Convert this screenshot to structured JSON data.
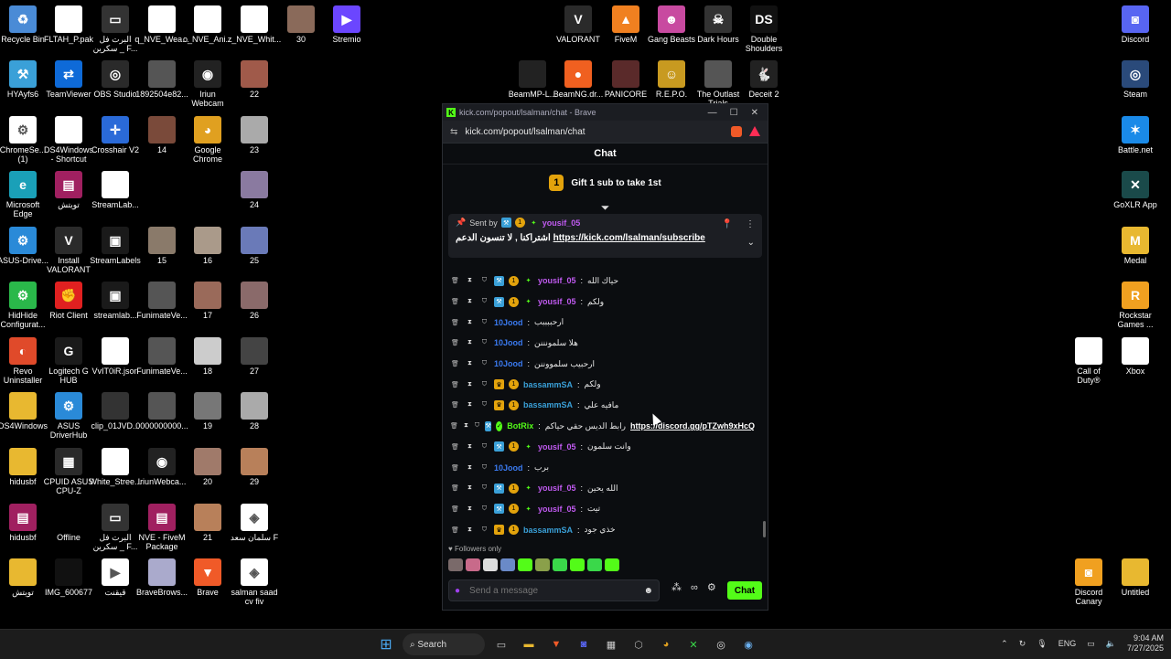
{
  "desktop_icons": [
    {
      "label": "Recycle Bin",
      "color": "#4a8bd6",
      "glyph": "♻"
    },
    {
      "label": "FLTAH_P.pak",
      "color": "#ffffff",
      "glyph": ""
    },
    {
      "label": "البرت فل\nسكرين _ F...",
      "color": "#333",
      "glyph": "▭"
    },
    {
      "label": "q_NVE_Wea...",
      "color": "#ffffff",
      "glyph": ""
    },
    {
      "label": "o_NVE_Ani...",
      "color": "#ffffff",
      "glyph": ""
    },
    {
      "label": "z_NVE_Whit...",
      "color": "#ffffff",
      "glyph": ""
    },
    {
      "label": "30",
      "color": "#8a6a5a",
      "glyph": ""
    },
    {
      "label": "Stremio",
      "color": "#6b46ff",
      "glyph": "▶"
    },
    {
      "label": "HYAyfs6",
      "color": "#3aa0d8",
      "glyph": "⚒"
    },
    {
      "label": "TeamViewer",
      "color": "#0e6ad8",
      "glyph": "⇄"
    },
    {
      "label": "OBS Studio",
      "color": "#2a2a2a",
      "glyph": "◎"
    },
    {
      "label": "1892504e82...",
      "color": "#555",
      "glyph": ""
    },
    {
      "label": "Iriun\nWebcam",
      "color": "#222",
      "glyph": "◉"
    },
    {
      "label": "22",
      "color": "#a05a4a",
      "glyph": ""
    },
    {
      "label": "ChromeSe...\n(1)",
      "color": "#ffffff",
      "glyph": "⚙"
    },
    {
      "label": "DS4Windows\n- Shortcut",
      "color": "#ffffff",
      "glyph": ""
    },
    {
      "label": "Crosshair V2",
      "color": "#2a6ad8",
      "glyph": "✛"
    },
    {
      "label": "14",
      "color": "#7a4a3a",
      "glyph": ""
    },
    {
      "label": "Google\nChrome",
      "color": "#e0a020",
      "glyph": "◕"
    },
    {
      "label": "23",
      "color": "#aaa",
      "glyph": ""
    },
    {
      "label": "Microsoft\nEdge",
      "color": "#1aa0b8",
      "glyph": "e"
    },
    {
      "label": "تويتش",
      "color": "#a02060",
      "glyph": "▤"
    },
    {
      "label": "StreamLab...",
      "color": "#ffffff",
      "glyph": ""
    },
    {
      "label": "24",
      "color": "#8a7aa0",
      "glyph": ""
    },
    {
      "label": "ASUS-Drive...",
      "color": "#2a8ad8",
      "glyph": "⚙"
    },
    {
      "label": "Install\nVALORANT",
      "color": "#2a2a2a",
      "glyph": "V"
    },
    {
      "label": "StreamLabels",
      "color": "#1a1a1a",
      "glyph": "▣"
    },
    {
      "label": "15",
      "color": "#8a7a6a",
      "glyph": ""
    },
    {
      "label": "16",
      "color": "#aa9a8a",
      "glyph": ""
    },
    {
      "label": "25",
      "color": "#6a7ab8",
      "glyph": ""
    },
    {
      "label": "HidHide\nConfigurat...",
      "color": "#2ab84a",
      "glyph": "⚙"
    },
    {
      "label": "Riot Client",
      "color": "#e02020",
      "glyph": "✊"
    },
    {
      "label": "streamlab...",
      "color": "#1a1a1a",
      "glyph": "▣"
    },
    {
      "label": "FunimateVe...",
      "color": "#555",
      "glyph": ""
    },
    {
      "label": "17",
      "color": "#9a6a5a",
      "glyph": ""
    },
    {
      "label": "26",
      "color": "#8a6a6a",
      "glyph": ""
    },
    {
      "label": "Revo\nUninstaller",
      "color": "#e04a2a",
      "glyph": "◐"
    },
    {
      "label": "Logitech G\nHUB",
      "color": "#1a1a1a",
      "glyph": "G"
    },
    {
      "label": "VvIT0iR.json",
      "color": "#ffffff",
      "glyph": ""
    },
    {
      "label": "FunimateVe...",
      "color": "#555",
      "glyph": ""
    },
    {
      "label": "18",
      "color": "#ccc",
      "glyph": ""
    },
    {
      "label": "27",
      "color": "#444",
      "glyph": ""
    },
    {
      "label": "DS4Windows",
      "color": "#e8b830",
      "glyph": ""
    },
    {
      "label": "ASUS\nDriverHub",
      "color": "#2a8ad8",
      "glyph": "⚙"
    },
    {
      "label": "clip_01JVD...",
      "color": "#333",
      "glyph": ""
    },
    {
      "label": "0000000000...",
      "color": "#555",
      "glyph": ""
    },
    {
      "label": "19",
      "color": "#777",
      "glyph": ""
    },
    {
      "label": "28",
      "color": "#aaa",
      "glyph": ""
    },
    {
      "label": "hidusbf",
      "color": "#e8b830",
      "glyph": ""
    },
    {
      "label": "CPUID ASUS\nCPU-Z",
      "color": "#2a2a2a",
      "glyph": "▦"
    },
    {
      "label": "White_Stree...",
      "color": "#ffffff",
      "glyph": ""
    },
    {
      "label": "IriunWebca...",
      "color": "#222",
      "glyph": "◉"
    },
    {
      "label": "20",
      "color": "#a07a6a",
      "glyph": ""
    },
    {
      "label": "29",
      "color": "#b8805a",
      "glyph": ""
    },
    {
      "label": "hidusbf",
      "color": "#a02060",
      "glyph": "▤"
    },
    {
      "label": "Offline",
      "color": "#000",
      "glyph": ""
    },
    {
      "label": "البرت فل\nسكرين _ F...",
      "color": "#333",
      "glyph": "▭"
    },
    {
      "label": "NVE - FiveM\nPackage",
      "color": "#a02060",
      "glyph": "▤"
    },
    {
      "label": "21",
      "color": "#b8805a",
      "glyph": ""
    },
    {
      "label": "سلمان سعد F",
      "color": "#ffffff",
      "glyph": "◈"
    },
    {
      "label": "تويتش",
      "color": "#e8b830",
      "glyph": ""
    },
    {
      "label": "IMG_600677",
      "color": "#111",
      "glyph": ""
    },
    {
      "label": "قيقنت",
      "color": "#ffffff",
      "glyph": "▶"
    },
    {
      "label": "BraveBrows...",
      "color": "#aac",
      "glyph": ""
    },
    {
      "label": "Brave",
      "color": "#f05a28",
      "glyph": "▼"
    },
    {
      "label": "salman saad\ncv fiv",
      "color": "#ffffff",
      "glyph": "◈"
    },
    {
      "label": "VALORANT",
      "color": "#2a2a2a",
      "glyph": "V"
    },
    {
      "label": "FiveM",
      "color": "#f08020",
      "glyph": "▲"
    },
    {
      "label": "Gang Beasts",
      "color": "#c84aa0",
      "glyph": "☻"
    },
    {
      "label": "Dark Hours",
      "color": "#333",
      "glyph": "☠"
    },
    {
      "label": "Double\nShoulders",
      "color": "#111",
      "glyph": "DS"
    },
    {
      "label": "BeamMP-L...",
      "color": "#222",
      "glyph": ""
    },
    {
      "label": "BeamNG.dr...",
      "color": "#f06020",
      "glyph": "●"
    },
    {
      "label": "PANICORE",
      "color": "#5a2a2a",
      "glyph": ""
    },
    {
      "label": "R.E.P.O.",
      "color": "#c89a20",
      "glyph": "☺"
    },
    {
      "label": "The Outlast\nTrials",
      "color": "#555",
      "glyph": ""
    },
    {
      "label": "Deceit 2",
      "color": "#222",
      "glyph": "🐇"
    },
    {
      "label": "Discord",
      "color": "#5865f2",
      "glyph": "◙"
    },
    {
      "label": "Steam",
      "color": "#2a4a7a",
      "glyph": "◎"
    },
    {
      "label": "Battle.net",
      "color": "#1a8ae8",
      "glyph": "✶"
    },
    {
      "label": "GoXLR App",
      "color": "#1a4a4a",
      "glyph": "✕"
    },
    {
      "label": "Medal",
      "color": "#e8b830",
      "glyph": "M"
    },
    {
      "label": "Rockstar\nGames ...",
      "color": "#f0a020",
      "glyph": "R"
    },
    {
      "label": "Call of\nDuty®",
      "color": "#ffffff",
      "glyph": ""
    },
    {
      "label": "Xbox",
      "color": "#ffffff",
      "glyph": ""
    },
    {
      "label": "Discord\nCanary",
      "color": "#f0a020",
      "glyph": "◙"
    },
    {
      "label": "Untitled",
      "color": "#e8b830",
      "glyph": ""
    }
  ],
  "window": {
    "title": "kick.com/popout/lsalman/chat - Brave",
    "url": "kick.com/popout/lsalman/chat",
    "chat_title": "Chat",
    "gift": {
      "coin": "1",
      "text": "Gift 1 sub to take 1st"
    },
    "pinned": {
      "sent_by": "Sent by",
      "user": "yousif_05",
      "text": "اشتراكنا , لا تنسون الدعم",
      "link": "https://kick.com/lsalman/subscribe"
    },
    "messages": [
      {
        "user": "yousif_05",
        "color": "#c05af0",
        "badges": [
          "og",
          "sub",
          "star"
        ],
        "text": "حياك الله"
      },
      {
        "user": "yousif_05",
        "color": "#c05af0",
        "badges": [
          "og",
          "sub",
          "star"
        ],
        "text": "ولكم"
      },
      {
        "user": "10Jood",
        "color": "#3a7af0",
        "badges": [],
        "text": "ارحببببب"
      },
      {
        "user": "10Jood",
        "color": "#3a7af0",
        "badges": [],
        "text": "هلا سلمونننن"
      },
      {
        "user": "10Jood",
        "color": "#3a7af0",
        "badges": [],
        "text": "ارحبيب سلمووننن"
      },
      {
        "user": "bassammSA",
        "color": "#3aa0d8",
        "badges": [
          "crown",
          "sub"
        ],
        "text": "ولكم"
      },
      {
        "user": "bassammSA",
        "color": "#3aa0d8",
        "badges": [
          "crown",
          "sub"
        ],
        "text": "مافيه علي"
      },
      {
        "user": "BotRix",
        "color": "#53fc18",
        "badges": [
          "og",
          "ver"
        ],
        "text": "رابط الديس حقي حياكم",
        "link": "https://discord.gg/pTZwh9xHcQ"
      },
      {
        "user": "yousif_05",
        "color": "#c05af0",
        "badges": [
          "og",
          "sub",
          "star"
        ],
        "text": "وانت سلمون"
      },
      {
        "user": "10Jood",
        "color": "#3a7af0",
        "badges": [],
        "text": "برب"
      },
      {
        "user": "yousif_05",
        "color": "#c05af0",
        "badges": [
          "og",
          "sub",
          "star"
        ],
        "text": "الله يحين"
      },
      {
        "user": "yousif_05",
        "color": "#c05af0",
        "badges": [
          "og",
          "sub",
          "star"
        ],
        "text": "تيت"
      },
      {
        "user": "bassammSA",
        "color": "#3aa0d8",
        "badges": [
          "crown",
          "sub"
        ],
        "text": "خذي جود"
      }
    ],
    "followers_only": "Followers only",
    "input_placeholder": "Send a message",
    "chat_button": "Chat"
  },
  "taskbar": {
    "search_label": "Search",
    "lang": "ENG",
    "time": "9:04 AM",
    "date": "7/27/2025"
  }
}
